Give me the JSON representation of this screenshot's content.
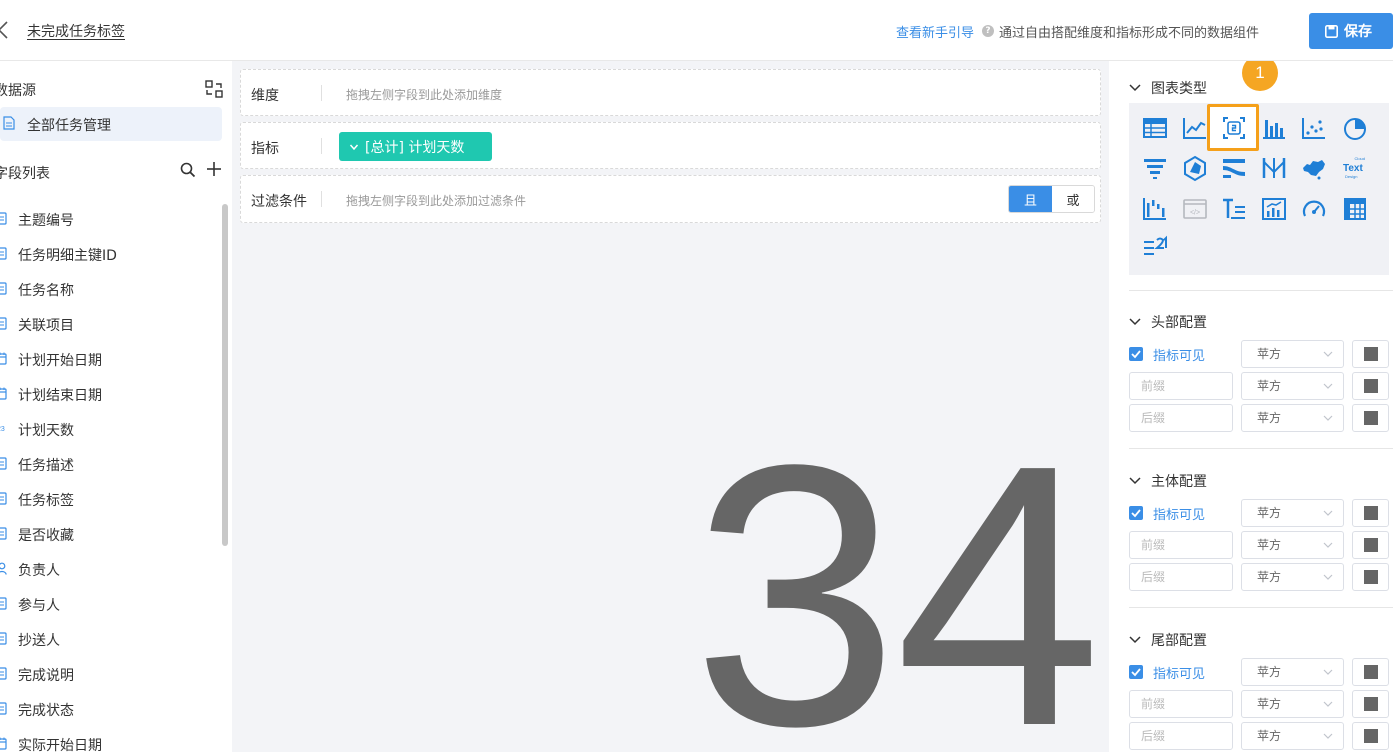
{
  "header": {
    "title": "未完成任务标签",
    "guide_link": "查看新手引导",
    "description": "通过自由搭配维度和指标形成不同的数据组件",
    "save_label": "保存"
  },
  "sidebar": {
    "datasource_heading": "数据源",
    "datasource_item": "全部任务管理",
    "fields_heading": "字段列表",
    "fields": [
      {
        "label": "主题编号",
        "icon": "text-field-icon"
      },
      {
        "label": "任务明细主键ID",
        "icon": "text-field-icon"
      },
      {
        "label": "任务名称",
        "icon": "text-field-icon"
      },
      {
        "label": "关联项目",
        "icon": "text-field-icon"
      },
      {
        "label": "计划开始日期",
        "icon": "date-field-icon"
      },
      {
        "label": "计划结束日期",
        "icon": "date-field-icon"
      },
      {
        "label": "计划天数",
        "icon": "number-field-icon"
      },
      {
        "label": "任务描述",
        "icon": "text-field-icon"
      },
      {
        "label": "任务标签",
        "icon": "text-field-icon"
      },
      {
        "label": "是否收藏",
        "icon": "text-field-icon"
      },
      {
        "label": "负责人",
        "icon": "user-field-icon"
      },
      {
        "label": "参与人",
        "icon": "text-field-icon"
      },
      {
        "label": "抄送人",
        "icon": "text-field-icon"
      },
      {
        "label": "完成说明",
        "icon": "text-field-icon"
      },
      {
        "label": "完成状态",
        "icon": "text-field-icon"
      },
      {
        "label": "实际开始日期",
        "icon": "date-field-icon"
      }
    ]
  },
  "canvas": {
    "dimension_label": "维度",
    "dimension_placeholder": "拖拽左侧字段到此处添加维度",
    "metric_label": "指标",
    "metric_chip": "[总计] 计划天数",
    "filter_label": "过滤条件",
    "filter_placeholder": "拖拽左侧字段到此处添加过滤条件",
    "logic_and": "且",
    "logic_or": "或",
    "big_value": "34"
  },
  "right_panel": {
    "chart_type_title": "图表类型",
    "step_badge": "1",
    "chart_types": [
      "table-chart-icon",
      "line-chart-icon",
      "metric-card-icon",
      "bar-chart-icon",
      "scatter-chart-icon",
      "pie-chart-icon",
      "funnel-chart-icon",
      "polar-chart-icon",
      "sankey-chart-icon",
      "bidirectional-chart-icon",
      "map-chart-icon",
      "word-cloud-icon",
      "waterfall-chart-icon",
      "iframe-chart-icon",
      "text-chart-icon",
      "comparison-chart-icon",
      "gauge-chart-icon",
      "pivot-table-icon",
      "ranking-list-icon"
    ],
    "word_cloud_text": "Text",
    "word_cloud_small_1": "Cloud",
    "word_cloud_small_2": "Design",
    "sections": [
      {
        "title": "头部配置",
        "check_label": "指标可见",
        "prefix_placeholder": "前缀",
        "suffix_placeholder": "后缀",
        "font": "苹方"
      },
      {
        "title": "主体配置",
        "check_label": "指标可见",
        "prefix_placeholder": "前缀",
        "suffix_placeholder": "后缀",
        "font": "苹方"
      },
      {
        "title": "尾部配置",
        "check_label": "指标可见",
        "prefix_placeholder": "前缀",
        "suffix_placeholder": "后缀",
        "font": "苹方"
      }
    ]
  },
  "colors": {
    "primary": "#3a8ee6",
    "chip": "#1fc8b0",
    "highlight": "#f5a01a",
    "value_text": "#666666"
  }
}
